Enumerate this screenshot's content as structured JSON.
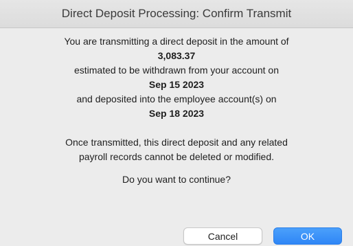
{
  "window": {
    "title": "Direct Deposit Processing: Confirm Transmit"
  },
  "message": {
    "line1": "You are transmitting a direct deposit in the amount of",
    "amount": "3,083.37",
    "line2": "estimated to be withdrawn from your account on",
    "withdraw_date": "Sep 15 2023",
    "line3": "and deposited into the employee account(s) on",
    "deposit_date": "Sep 18 2023",
    "warning_line1": "Once transmitted, this direct deposit and any related",
    "warning_line2": "payroll records cannot be deleted or modified.",
    "question": "Do you want to continue?"
  },
  "buttons": {
    "cancel_label": "Cancel",
    "ok_label": "OK"
  },
  "colors": {
    "accent": "#2f86f6",
    "background": "#ececec"
  }
}
